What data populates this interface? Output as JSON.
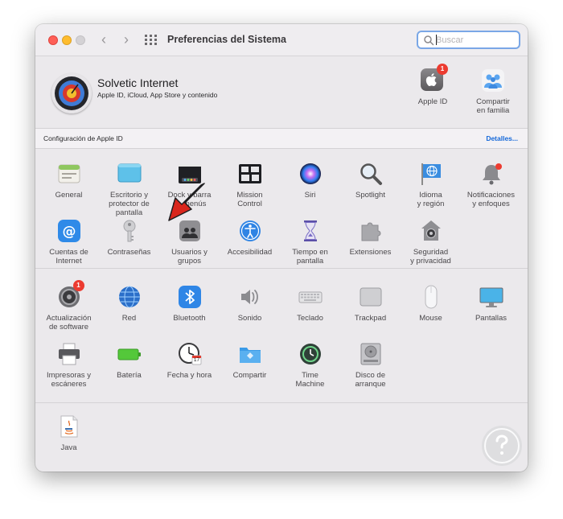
{
  "window": {
    "title": "Preferencias del Sistema",
    "search_placeholder": "Buscar"
  },
  "account": {
    "name": "Solvetic Internet",
    "subtitle": "Apple ID, iCloud, App Store y contenido",
    "apple_id_label": "Apple ID",
    "apple_id_badge": "1",
    "family_label_line1": "Compartir",
    "family_label_line2": "en familia"
  },
  "id_bar": {
    "label": "Configuración de Apple ID",
    "details": "Detalles..."
  },
  "row1": [
    {
      "l1": "General",
      "l2": "",
      "icon": "general-icon"
    },
    {
      "l1": "Escritorio y",
      "l2": "protector de pantalla",
      "icon": "desktop-icon"
    },
    {
      "l1": "Dock y barra",
      "l2": "de menús",
      "icon": "dock-icon"
    },
    {
      "l1": "Mission",
      "l2": "Control",
      "icon": "mission-control-icon"
    },
    {
      "l1": "Siri",
      "l2": "",
      "icon": "siri-icon"
    },
    {
      "l1": "Spotlight",
      "l2": "",
      "icon": "spotlight-icon"
    },
    {
      "l1": "Idioma",
      "l2": "y región",
      "icon": "language-icon"
    },
    {
      "l1": "Notificaciones",
      "l2": "y enfoques",
      "icon": "notifications-icon"
    }
  ],
  "row2": [
    {
      "l1": "Cuentas de",
      "l2": "Internet",
      "icon": "internet-accounts-icon"
    },
    {
      "l1": "Contraseñas",
      "l2": "",
      "icon": "passwords-icon"
    },
    {
      "l1": "Usuarios y",
      "l2": "grupos",
      "icon": "users-groups-icon"
    },
    {
      "l1": "Accesibilidad",
      "l2": "",
      "icon": "accessibility-icon"
    },
    {
      "l1": "Tiempo en",
      "l2": "pantalla",
      "icon": "screen-time-icon"
    },
    {
      "l1": "Extensiones",
      "l2": "",
      "icon": "extensions-icon"
    },
    {
      "l1": "Seguridad",
      "l2": "y privacidad",
      "icon": "security-icon"
    }
  ],
  "row3": [
    {
      "l1": "Actualización",
      "l2": "de software",
      "icon": "software-update-icon",
      "badge": "1"
    },
    {
      "l1": "Red",
      "l2": "",
      "icon": "network-icon"
    },
    {
      "l1": "Bluetooth",
      "l2": "",
      "icon": "bluetooth-icon"
    },
    {
      "l1": "Sonido",
      "l2": "",
      "icon": "sound-icon"
    },
    {
      "l1": "Teclado",
      "l2": "",
      "icon": "keyboard-icon"
    },
    {
      "l1": "Trackpad",
      "l2": "",
      "icon": "trackpad-icon"
    },
    {
      "l1": "Mouse",
      "l2": "",
      "icon": "mouse-icon"
    },
    {
      "l1": "Pantallas",
      "l2": "",
      "icon": "displays-icon"
    }
  ],
  "row4": [
    {
      "l1": "Impresoras y",
      "l2": "escáneres",
      "icon": "printers-icon"
    },
    {
      "l1": "Batería",
      "l2": "",
      "icon": "battery-icon"
    },
    {
      "l1": "Fecha y hora",
      "l2": "",
      "icon": "date-time-icon",
      "date_number": "17"
    },
    {
      "l1": "Compartir",
      "l2": "",
      "icon": "sharing-icon"
    },
    {
      "l1": "Time",
      "l2": "Machine",
      "icon": "time-machine-icon"
    },
    {
      "l1": "Disco de",
      "l2": "arranque",
      "icon": "startup-disk-icon"
    }
  ],
  "row5": [
    {
      "l1": "Java",
      "l2": "",
      "icon": "java-icon"
    }
  ],
  "colors": {
    "accent": "#1468d9",
    "badge": "#ec3b30",
    "annotation_arrow": "#d9261c"
  }
}
